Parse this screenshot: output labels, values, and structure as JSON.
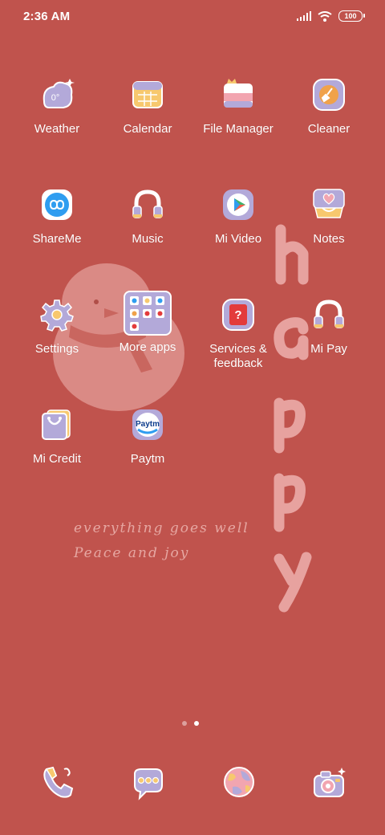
{
  "status_bar": {
    "time": "2:36 AM",
    "battery": "100"
  },
  "apps": [
    {
      "name": "weather",
      "label": "Weather",
      "icon": "weather-icon"
    },
    {
      "name": "calendar",
      "label": "Calendar",
      "icon": "calendar-icon"
    },
    {
      "name": "file-manager",
      "label": "File Manager",
      "icon": "folder-icon"
    },
    {
      "name": "cleaner",
      "label": "Cleaner",
      "icon": "broom-icon"
    },
    {
      "name": "shareme",
      "label": "ShareMe",
      "icon": "infinity-icon"
    },
    {
      "name": "music",
      "label": "Music",
      "icon": "headphones-icon"
    },
    {
      "name": "mi-video",
      "label": "Mi Video",
      "icon": "play-icon"
    },
    {
      "name": "notes",
      "label": "Notes",
      "icon": "heart-note-icon"
    },
    {
      "name": "settings",
      "label": "Settings",
      "icon": "gear-icon"
    },
    {
      "name": "more-apps",
      "label": "More apps",
      "icon": "folder-grid-icon"
    },
    {
      "name": "services-feedback",
      "label": "Services &\nfeedback",
      "icon": "question-icon"
    },
    {
      "name": "mi-pay",
      "label": "Mi Pay",
      "icon": "headphones-icon"
    },
    {
      "name": "mi-credit",
      "label": "Mi Credit",
      "icon": "bag-icon"
    },
    {
      "name": "paytm",
      "label": "Paytm",
      "icon": "paytm-logo"
    }
  ],
  "wallpaper": {
    "tagline_1": "everything goes well",
    "tagline_2": "Peace and joy",
    "word": [
      "h",
      "a",
      "p",
      "p",
      "y"
    ]
  },
  "pager": {
    "pages": 2,
    "active": 2
  },
  "dock": [
    "phone-icon",
    "message-icon",
    "browser-globe-icon",
    "camera-icon"
  ],
  "colors": {
    "background": "#c0534d",
    "icon_lavender": "#b3a9d9",
    "icon_yellow": "#f7c86e",
    "icon_pink": "#f2a5b0"
  }
}
